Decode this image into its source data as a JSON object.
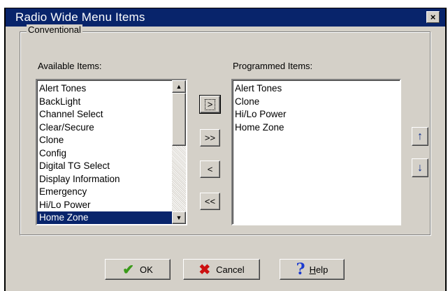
{
  "window": {
    "title": "Radio Wide Menu Items",
    "close_glyph": "×"
  },
  "group": {
    "label": "Conventional"
  },
  "available": {
    "label": "Available Items:",
    "items": [
      "Alert Tones",
      "BackLight",
      "Channel Select",
      "Clear/Secure",
      "Clone",
      "Config",
      "Digital TG Select",
      "Display Information",
      "Emergency",
      "Hi/Lo Power",
      "Home Zone"
    ],
    "selected": "Home Zone"
  },
  "programmed": {
    "label": "Programmed Items:",
    "items": [
      "Alert Tones",
      "Clone",
      "Hi/Lo Power",
      "Home Zone"
    ]
  },
  "transfer_buttons": {
    "add": ">",
    "add_all": ">>",
    "remove": "<",
    "remove_all": "<<"
  },
  "order_buttons": {
    "up": "↑",
    "down": "↓"
  },
  "scrollbar": {
    "up": "▲",
    "down": "▼"
  },
  "footer": {
    "ok": "OK",
    "cancel": "Cancel",
    "help_prefix": "",
    "help_underline": "H",
    "help_rest": "elp"
  },
  "icons": {
    "ok": "check-icon",
    "cancel": "x-icon",
    "help": "question-icon"
  },
  "colors": {
    "title_bar": "#08246b",
    "selection": "#08246b",
    "dialog_bg": "#d4d0c8"
  }
}
